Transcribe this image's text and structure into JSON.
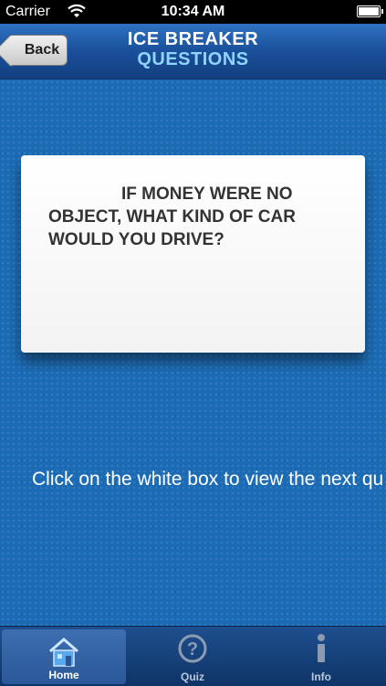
{
  "status_bar": {
    "carrier": "Carrier",
    "time": "10:34 AM"
  },
  "nav": {
    "back_label": "Back",
    "title_line1": "ICE BREAKER",
    "title_line2": "QUESTIONS"
  },
  "card": {
    "question": "IF MONEY WERE NO OBJECT, WHAT KIND OF CAR WOULD YOU DRIVE?"
  },
  "hint": "Click on the white box to view the next qu",
  "tabs": [
    {
      "label": "Home",
      "icon": "home-icon",
      "selected": true
    },
    {
      "label": "Quiz",
      "icon": "question-icon",
      "selected": false
    },
    {
      "label": "Info",
      "icon": "info-icon",
      "selected": false
    }
  ],
  "colors": {
    "background": "#1b6bb4",
    "title_accent": "#8fd3ff"
  }
}
